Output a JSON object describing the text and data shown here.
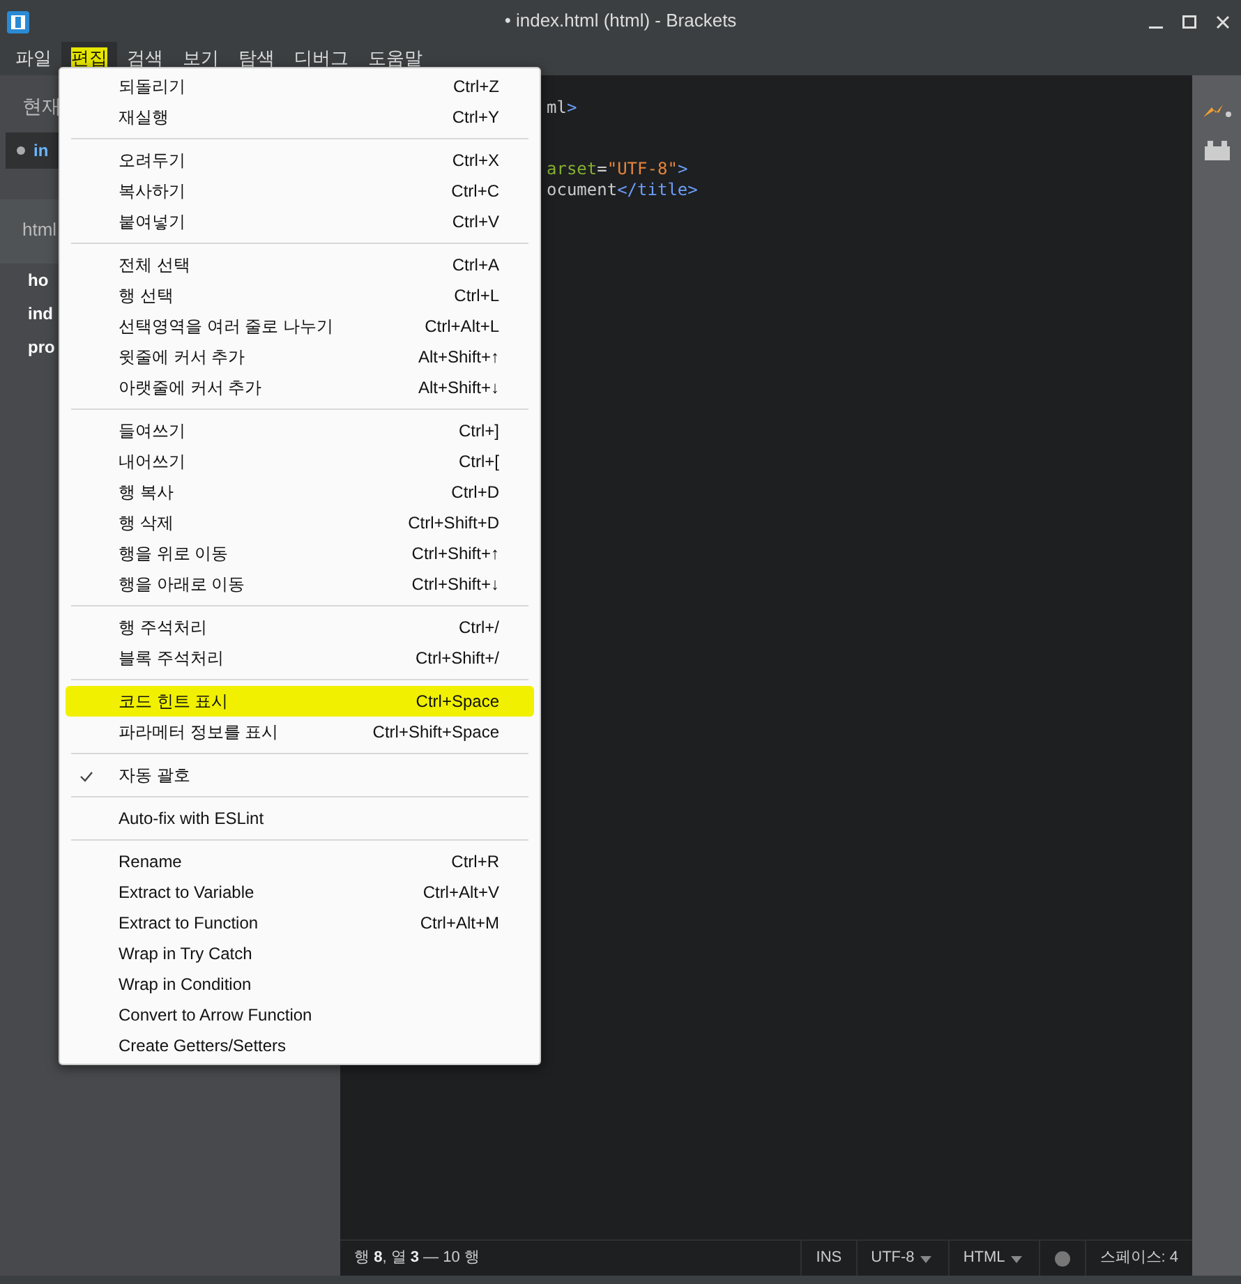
{
  "window": {
    "title": "• index.html (html) - Brackets"
  },
  "menubar": [
    {
      "label": "파일",
      "selected": false
    },
    {
      "label": "편집",
      "selected": true
    },
    {
      "label": "검색",
      "selected": false
    },
    {
      "label": "보기",
      "selected": false
    },
    {
      "label": "탐색",
      "selected": false
    },
    {
      "label": "디버그",
      "selected": false
    },
    {
      "label": "도움말",
      "selected": false
    }
  ],
  "sidebar": {
    "working_files_header": "현재",
    "working_files": [
      {
        "name": "in",
        "selected": true
      }
    ],
    "project_header": "html",
    "files": [
      "ho",
      "ind",
      "pro"
    ]
  },
  "editor": {
    "lines": [
      {
        "segments": [
          {
            "text": "ml",
            "kind": "plain"
          },
          {
            "text": ">",
            "kind": "tag"
          }
        ]
      },
      {
        "segments": [
          {
            "text": "arset",
            "kind": "attr"
          },
          {
            "text": "=",
            "kind": "plain"
          },
          {
            "text": "\"UTF-8\"",
            "kind": "string"
          },
          {
            "text": ">",
            "kind": "tag"
          }
        ]
      },
      {
        "segments": [
          {
            "text": "ocument",
            "kind": "plain"
          },
          {
            "text": "</title>",
            "kind": "tag"
          }
        ]
      }
    ]
  },
  "edit_menu": [
    [
      {
        "label": "되돌리기",
        "shortcut": "Ctrl+Z",
        "checked": false,
        "selected": false
      },
      {
        "label": "재실행",
        "shortcut": "Ctrl+Y",
        "checked": false,
        "selected": false
      }
    ],
    [
      {
        "label": "오려두기",
        "shortcut": "Ctrl+X",
        "checked": false,
        "selected": false
      },
      {
        "label": "복사하기",
        "shortcut": "Ctrl+C",
        "checked": false,
        "selected": false
      },
      {
        "label": "붙여넣기",
        "shortcut": "Ctrl+V",
        "checked": false,
        "selected": false
      }
    ],
    [
      {
        "label": "전체 선택",
        "shortcut": "Ctrl+A",
        "checked": false,
        "selected": false
      },
      {
        "label": "행 선택",
        "shortcut": "Ctrl+L",
        "checked": false,
        "selected": false
      },
      {
        "label": "선택영역을 여러 줄로 나누기",
        "shortcut": "Ctrl+Alt+L",
        "checked": false,
        "selected": false
      },
      {
        "label": "윗줄에 커서 추가",
        "shortcut": "Alt+Shift+↑",
        "checked": false,
        "selected": false
      },
      {
        "label": "아랫줄에 커서 추가",
        "shortcut": "Alt+Shift+↓",
        "checked": false,
        "selected": false
      }
    ],
    [
      {
        "label": "들여쓰기",
        "shortcut": "Ctrl+]",
        "checked": false,
        "selected": false
      },
      {
        "label": "내어쓰기",
        "shortcut": "Ctrl+[",
        "checked": false,
        "selected": false
      },
      {
        "label": "행 복사",
        "shortcut": "Ctrl+D",
        "checked": false,
        "selected": false
      },
      {
        "label": "행 삭제",
        "shortcut": "Ctrl+Shift+D",
        "checked": false,
        "selected": false
      },
      {
        "label": "행을 위로 이동",
        "shortcut": "Ctrl+Shift+↑",
        "checked": false,
        "selected": false
      },
      {
        "label": "행을 아래로 이동",
        "shortcut": "Ctrl+Shift+↓",
        "checked": false,
        "selected": false
      }
    ],
    [
      {
        "label": "행 주석처리",
        "shortcut": "Ctrl+/",
        "checked": false,
        "selected": false
      },
      {
        "label": "블록 주석처리",
        "shortcut": "Ctrl+Shift+/",
        "checked": false,
        "selected": false
      }
    ],
    [
      {
        "label": "코드 힌트 표시",
        "shortcut": "Ctrl+Space",
        "checked": false,
        "selected": true
      },
      {
        "label": "파라메터 정보를 표시",
        "shortcut": "Ctrl+Shift+Space",
        "checked": false,
        "selected": false
      }
    ],
    [
      {
        "label": "자동 괄호",
        "checked": true,
        "selected": false
      }
    ],
    [
      {
        "label": "Auto-fix with ESLint",
        "checked": false,
        "selected": false
      }
    ],
    [
      {
        "label": "Rename",
        "shortcut": "Ctrl+R",
        "checked": false,
        "selected": false
      },
      {
        "label": "Extract to Variable",
        "shortcut": "Ctrl+Alt+V",
        "checked": false,
        "selected": false
      },
      {
        "label": "Extract to Function",
        "shortcut": "Ctrl+Alt+M",
        "checked": false,
        "selected": false
      },
      {
        "label": "Wrap in Try Catch",
        "checked": false,
        "selected": false
      },
      {
        "label": "Wrap in Condition",
        "checked": false,
        "selected": false
      },
      {
        "label": "Convert to Arrow Function",
        "checked": false,
        "selected": false
      },
      {
        "label": "Create Getters/Setters",
        "checked": false,
        "selected": false
      }
    ]
  ],
  "status_bar": {
    "cursor": "행 **8**, 열 **3** — 10 행",
    "mode": "INS",
    "encoding": "UTF-8",
    "language": "HTML",
    "indent": "스페이스: 4"
  }
}
